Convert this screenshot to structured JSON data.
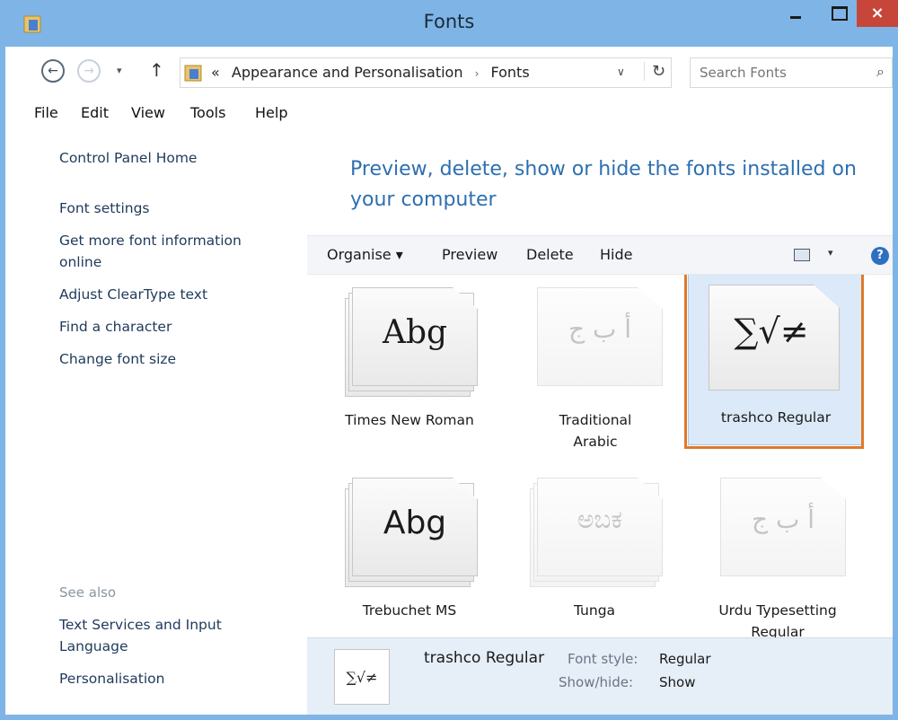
{
  "window": {
    "title": "Fonts",
    "close_glyph": "×",
    "icons": {
      "app": "folder-icon",
      "minimize": "minimize-icon",
      "maximize": "maximize-icon",
      "close": "close-icon"
    }
  },
  "address": {
    "recent_glyph": "▾",
    "back_glyph": "←",
    "forward_glyph": "→",
    "up_glyph": "↑",
    "prefix": "«",
    "crumbs": [
      "Appearance and Personalisation",
      "Fonts"
    ],
    "separator": "›",
    "dropdown_glyph": "∨",
    "refresh_glyph": "↻",
    "search_placeholder": "Search Fonts",
    "search_glyph": "⌕"
  },
  "menu": [
    "File",
    "Edit",
    "View",
    "Tools",
    "Help"
  ],
  "sidebar": {
    "links": [
      "Control Panel Home",
      "Font settings",
      "Get more font information online",
      "Adjust ClearType text",
      "Find a character",
      "Change font size"
    ],
    "see_also_label": "See also",
    "see_also_links": [
      "Text Services and Input Language",
      "Personalisation"
    ]
  },
  "heading": "Preview, delete, show or hide the fonts installed on your computer",
  "toolbar": {
    "organise": "Organise ▾",
    "preview": "Preview",
    "delete": "Delete",
    "hide": "Hide",
    "view_dropdown": "▾",
    "help": "?"
  },
  "fonts": [
    {
      "name": "Times New Roman",
      "sample": "Abg",
      "faded": false,
      "selected": false
    },
    {
      "name": "Traditional Arabic",
      "sample": "أ ب ج",
      "faded": true,
      "selected": false
    },
    {
      "name": "trashco Regular",
      "sample": "∑√≠",
      "faded": false,
      "selected": true
    },
    {
      "name": "Trebuchet MS",
      "sample": "Abg",
      "faded": false,
      "selected": false
    },
    {
      "name": "Tunga",
      "sample": "ಅಬಕ",
      "faded": true,
      "selected": false
    },
    {
      "name": "Urdu Typesetting Regular",
      "sample": "أ ب ج",
      "faded": true,
      "selected": false
    }
  ],
  "scrollbar": {
    "up_glyph": "▲"
  },
  "details": {
    "sample": "∑√≠",
    "name": "trashco Regular",
    "font_style_label": "Font style:",
    "font_style_value": "Regular",
    "show_hide_label": "Show/hide:",
    "show_hide_value": "Show"
  },
  "colors": {
    "title_bar": "#7fb5e6",
    "heading": "#2e6fb0",
    "highlight": "#e0792a",
    "selection": "#dbe9f8",
    "close": "#c7463a"
  }
}
